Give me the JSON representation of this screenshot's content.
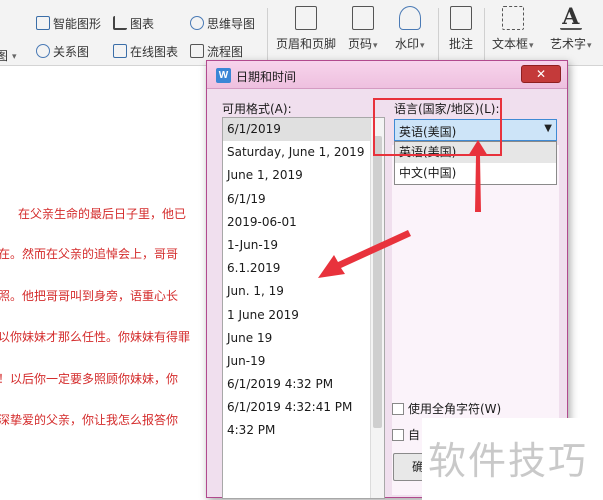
{
  "ribbon": {
    "items": [
      {
        "label": "智能图形",
        "icon": "smart-graphic-icon"
      },
      {
        "label": "图表",
        "icon": "chart-icon"
      },
      {
        "label": "思维导图",
        "icon": "mind-map-icon"
      },
      {
        "label": "关系图",
        "icon": "relation-chart-icon"
      },
      {
        "label": "在线图表",
        "icon": "online-chart-icon"
      },
      {
        "label": "流程图",
        "icon": "flowchart-icon"
      },
      {
        "label": "页眉和页脚",
        "icon": "header-footer-icon"
      },
      {
        "label": "页码",
        "icon": "page-number-icon"
      },
      {
        "label": "水印",
        "icon": "watermark-icon"
      },
      {
        "label": "批注",
        "icon": "comment-icon"
      },
      {
        "label": "文本框",
        "icon": "textbox-icon"
      },
      {
        "label": "艺术字",
        "icon": "wordart-icon"
      }
    ],
    "cut_label": "图"
  },
  "document": {
    "lines": [
      "在父亲生命的最后日子里，他已",
      "在。然而在父亲的追悼会上，哥哥",
      "照。他把哥哥叫到身旁，语重心长",
      "以你妹妹才那么任性。你妹妹有得罪",
      "！以后你一定要多照顾你妹妹，你",
      "深挚爱的父亲，你让我怎么报答你"
    ]
  },
  "dialog": {
    "title": "日期和时间",
    "app_icon_letter": "W",
    "close_glyph": "✕",
    "formats_label": "可用格式(A):",
    "language_label": "语言(国家/地区)(L):",
    "formats": [
      "6/1/2019",
      "Saturday, June 1, 2019",
      "June 1, 2019",
      "6/1/19",
      "2019-06-01",
      "1-Jun-19",
      "6.1.2019",
      "Jun. 1, 19",
      "1 June 2019",
      "June 19",
      "Jun-19",
      "6/1/2019 4:32 PM",
      "6/1/2019 4:32:41 PM",
      "4:32 PM"
    ],
    "selected_language": "英语(美国)",
    "language_options": [
      "英语(美国)",
      "中文(中国)"
    ],
    "fullwidth_label": "使用全角字符(W)",
    "auto_label": "自",
    "ok_label": "确"
  },
  "watermark": {
    "text": "软件技巧"
  },
  "colors": {
    "accent_red": "#e8323c",
    "doc_text": "#d42b2b",
    "dialog_border": "#b14a8e"
  }
}
